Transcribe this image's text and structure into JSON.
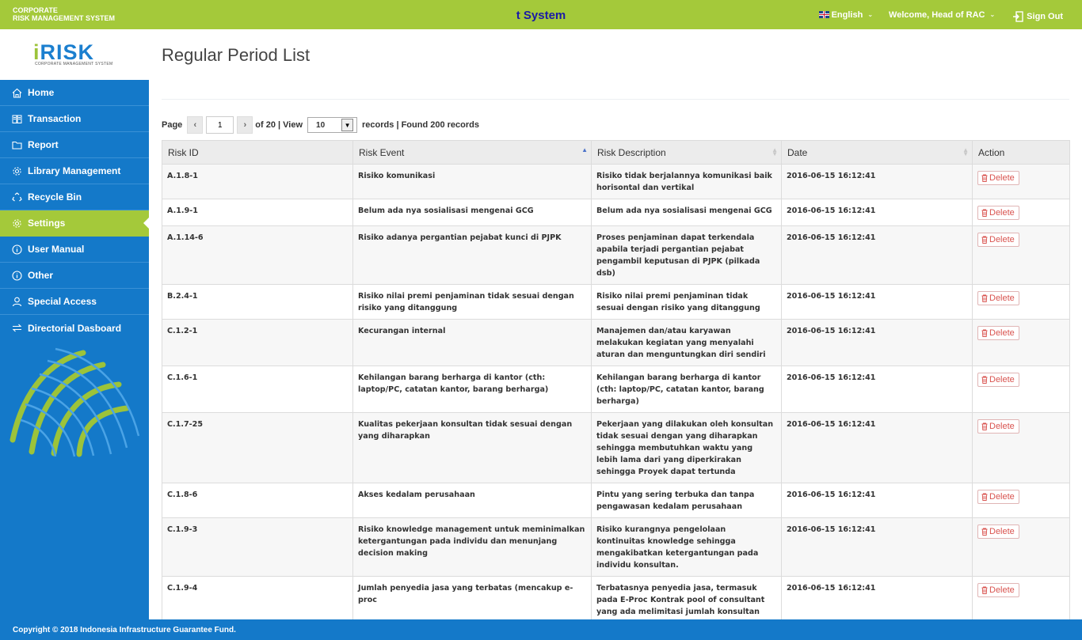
{
  "header": {
    "brand_line1": "CORPORATE",
    "brand_line2": "RISK MANAGEMENT SYSTEM",
    "system_title": "t System",
    "language": "English",
    "welcome": "Welcome, Head of RAC",
    "signout": "Sign Out",
    "colors": {
      "topbar": "#a4c93a",
      "title": "#1a1aa6"
    }
  },
  "logo": {
    "text_i": "i",
    "text_rest": "RISK",
    "subtitle": "CORPORATE MANAGEMENT SYSTEM"
  },
  "sidebar": {
    "items": [
      {
        "label": "Home",
        "icon": "home-icon",
        "active": false
      },
      {
        "label": "Transaction",
        "icon": "book-icon",
        "active": false
      },
      {
        "label": "Report",
        "icon": "folder-icon",
        "active": false
      },
      {
        "label": "Library Management",
        "icon": "gear-icon",
        "active": false
      },
      {
        "label": "Recycle Bin",
        "icon": "recycle-icon",
        "active": false
      },
      {
        "label": "Settings",
        "icon": "gear-icon",
        "active": true
      },
      {
        "label": "User Manual",
        "icon": "info-icon",
        "active": false
      },
      {
        "label": "Other",
        "icon": "info-icon",
        "active": false
      },
      {
        "label": "Special Access",
        "icon": "user-icon",
        "active": false
      },
      {
        "label": "Directorial Dasboard",
        "icon": "swap-icon",
        "active": false
      }
    ],
    "colors": {
      "background": "#1479c9",
      "active": "#a4c93a"
    }
  },
  "main": {
    "title": "Regular Period List",
    "pager": {
      "page_label": "Page",
      "prev": "‹",
      "page_value": "1",
      "next": "›",
      "of_text": "of 20 | View",
      "view_value": "10",
      "records_text": "records | Found 200 records"
    },
    "columns": [
      "Risk ID",
      "Risk Event",
      "Risk Description",
      "Date",
      "Action"
    ],
    "delete_label": "Delete",
    "rows": [
      {
        "id": "A.1.8-1",
        "event": "Risiko komunikasi",
        "desc": "Risiko tidak berjalannya komunikasi baik horisontal dan vertikal",
        "date": "2016-06-15 16:12:41"
      },
      {
        "id": "A.1.9-1",
        "event": "Belum ada nya sosialisasi mengenai GCG",
        "desc": "Belum ada nya sosialisasi mengenai GCG",
        "date": "2016-06-15 16:12:41"
      },
      {
        "id": "A.1.14-6",
        "event": "Risiko adanya pergantian pejabat kunci di PJPK",
        "desc": "Proses penjaminan dapat terkendala apabila terjadi pergantian pejabat pengambil keputusan di PJPK (pilkada dsb)",
        "date": "2016-06-15 16:12:41"
      },
      {
        "id": "B.2.4-1",
        "event": "Risiko nilai premi penjaminan tidak sesuai dengan risiko yang ditanggung",
        "desc": "Risiko nilai premi penjaminan tidak sesuai dengan risiko yang ditanggung",
        "date": "2016-06-15 16:12:41"
      },
      {
        "id": "C.1.2-1",
        "event": "Kecurangan internal",
        "desc": "Manajemen dan/atau karyawan melakukan kegiatan yang menyalahi aturan dan menguntungkan diri sendiri",
        "date": "2016-06-15 16:12:41"
      },
      {
        "id": "C.1.6-1",
        "event": "Kehilangan barang berharga di kantor (cth: laptop/PC, catatan kantor, barang berharga)",
        "desc": "Kehilangan barang berharga di kantor (cth: laptop/PC, catatan kantor, barang berharga)",
        "date": "2016-06-15 16:12:41"
      },
      {
        "id": "C.1.7-25",
        "event": "Kualitas pekerjaan konsultan tidak sesuai dengan yang diharapkan",
        "desc": "Pekerjaan yang dilakukan oleh konsultan tidak sesuai dengan yang diharapkan sehingga membutuhkan waktu yang lebih lama dari yang diperkirakan sehingga Proyek dapat tertunda",
        "date": "2016-06-15 16:12:41"
      },
      {
        "id": "C.1.8-6",
        "event": "Akses kedalam perusahaan",
        "desc": "Pintu yang sering terbuka dan tanpa pengawasan kedalam perusahaan",
        "date": "2016-06-15 16:12:41"
      },
      {
        "id": "C.1.9-3",
        "event": "Risiko knowledge management untuk meminimalkan ketergantungan pada individu dan menunjang decision making",
        "desc": "Risiko kurangnya pengelolaan kontinuitas knowledge sehingga mengakibatkan ketergantungan pada individu konsultan.",
        "date": "2016-06-15 16:12:41"
      },
      {
        "id": "C.1.9-4",
        "event": "Jumlah penyedia jasa yang terbatas (mencakup e-proc",
        "desc": "Terbatasnya penyedia jasa, termasuk pada E-Proc Kontrak pool of consultant yang ada melimitasi jumlah konsultan yang dapat digunakan",
        "date": "2016-06-15 16:12:41"
      }
    ]
  },
  "footer": {
    "copyright": "Copyright © 2018 Indonesia Infrastructure Guarantee Fund."
  }
}
